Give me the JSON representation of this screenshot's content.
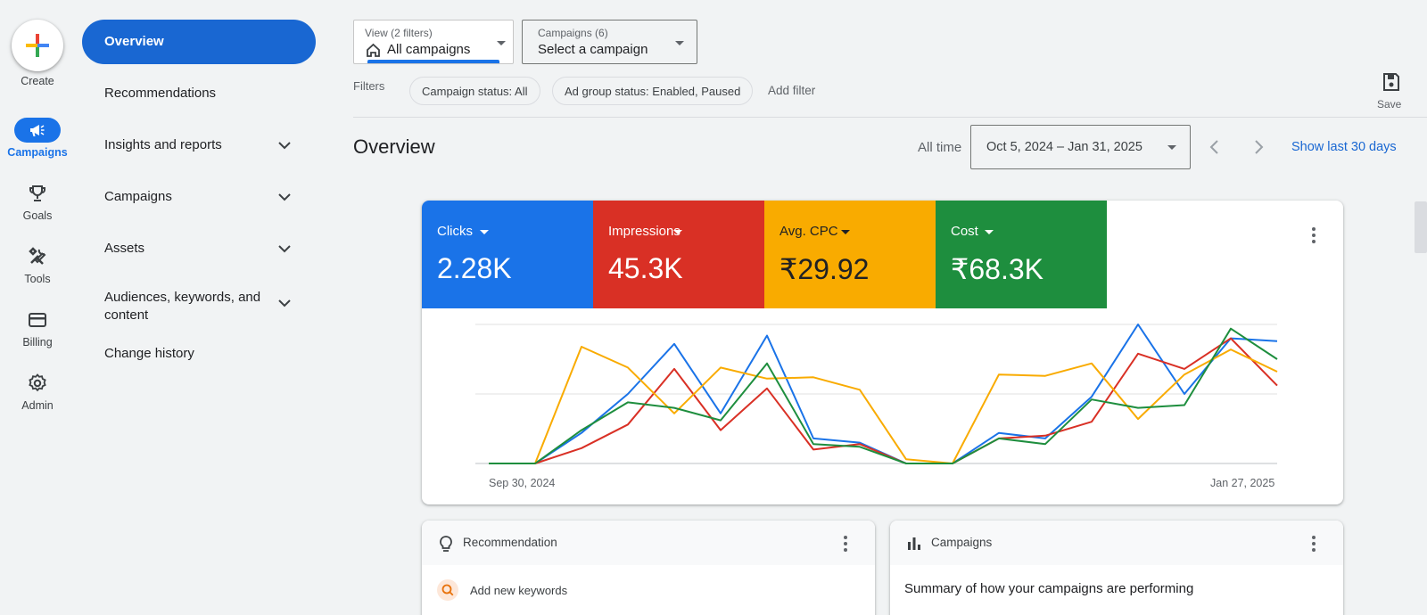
{
  "rail": {
    "create_label": "Create",
    "items": [
      {
        "label": "Campaigns",
        "icon": "megaphone-icon",
        "active": true
      },
      {
        "label": "Goals",
        "icon": "trophy-icon"
      },
      {
        "label": "Tools",
        "icon": "tools-icon"
      },
      {
        "label": "Billing",
        "icon": "credit-card-icon"
      },
      {
        "label": "Admin",
        "icon": "gear-icon"
      }
    ]
  },
  "nav": {
    "items": [
      {
        "label": "Overview",
        "active": true
      },
      {
        "label": "Recommendations"
      },
      {
        "label": "Insights and reports",
        "expandable": true
      },
      {
        "label": "Campaigns",
        "expandable": true
      },
      {
        "label": "Assets",
        "expandable": true
      },
      {
        "label": "Audiences, keywords, and content",
        "expandable": true
      },
      {
        "label": "Change history"
      }
    ]
  },
  "view": {
    "small": "View (2 filters)",
    "value": "All campaigns"
  },
  "campaign_select": {
    "small": "Campaigns (6)",
    "value": "Select a campaign"
  },
  "filters": {
    "label": "Filters",
    "chips": [
      "Campaign status: All",
      "Ad group status: Enabled, Paused"
    ],
    "add": "Add filter"
  },
  "save_label": "Save",
  "page": {
    "title": "Overview",
    "range_label": "All time",
    "date_range": "Oct 5, 2024 – Jan 31, 2025",
    "show_last": "Show last 30 days"
  },
  "metrics": [
    {
      "label": "Clicks",
      "value": "2.28K",
      "color": "#1a73e8"
    },
    {
      "label": "Impressions",
      "value": "45.3K",
      "color": "#d93025"
    },
    {
      "label": "Avg. CPC",
      "value": "₹29.92",
      "color": "#f9ab00"
    },
    {
      "label": "Cost",
      "value": "₹68.3K",
      "color": "#1e8e3e"
    }
  ],
  "chart_data": {
    "type": "line",
    "x_tick_labels": [
      "Sep 30, 2024",
      "Jan 27, 2025"
    ],
    "grid": true,
    "ylim": [
      0,
      100
    ],
    "series": [
      {
        "name": "Clicks",
        "color": "#1a73e8",
        "values": [
          0,
          0,
          22,
          50,
          86,
          36,
          92,
          18,
          15,
          0,
          0,
          22,
          18,
          48,
          100,
          50,
          90,
          88
        ]
      },
      {
        "name": "Impressions",
        "color": "#d93025",
        "values": [
          0,
          0,
          11,
          28,
          68,
          24,
          54,
          10,
          14,
          0,
          0,
          18,
          20,
          30,
          79,
          68,
          90,
          56
        ]
      },
      {
        "name": "Avg. CPC",
        "color": "#f9ab00",
        "values": [
          0,
          0,
          84,
          69,
          36,
          69,
          61,
          62,
          53,
          3,
          0,
          64,
          63,
          72,
          32,
          64,
          82,
          66
        ]
      },
      {
        "name": "Cost",
        "color": "#1e8e3e",
        "values": [
          0,
          0,
          24,
          44,
          40,
          31,
          72,
          14,
          12,
          0,
          0,
          18,
          14,
          46,
          40,
          42,
          97,
          75
        ]
      }
    ]
  },
  "recommendation_card": {
    "title": "Recommendation",
    "item": "Add new keywords"
  },
  "campaigns_card": {
    "title": "Campaigns",
    "summary": "Summary of how your campaigns are performing"
  }
}
